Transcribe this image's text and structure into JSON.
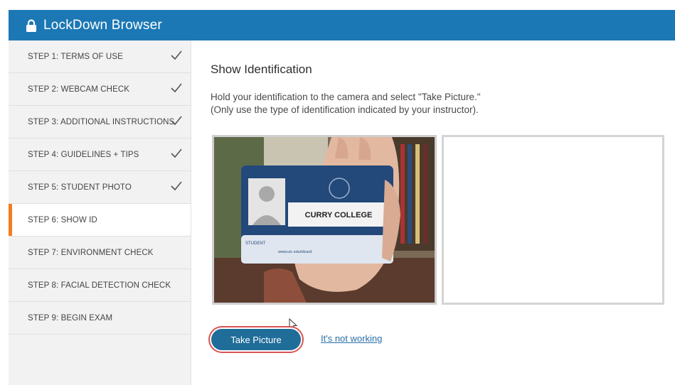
{
  "window": {
    "title": "LockDown Browser",
    "titlebar_color": "#1b78b5",
    "accent_color": "#ef7d22"
  },
  "sidebar": {
    "items": [
      {
        "label": "STEP 1: TERMS OF USE",
        "completed": true
      },
      {
        "label": "STEP 2: WEBCAM CHECK",
        "completed": true
      },
      {
        "label": "STEP 3: ADDITIONAL INSTRUCTIONS",
        "completed": true
      },
      {
        "label": "STEP 4: GUIDELINES + TIPS",
        "completed": true
      },
      {
        "label": "STEP 5: STUDENT PHOTO",
        "completed": true
      },
      {
        "label": "STEP 6: SHOW ID",
        "completed": false,
        "active": true
      },
      {
        "label": "STEP 7: ENVIRONMENT CHECK",
        "completed": false
      },
      {
        "label": "STEP 8: FACIAL DETECTION CHECK",
        "completed": false
      },
      {
        "label": "STEP 9: BEGIN EXAM",
        "completed": false
      }
    ]
  },
  "main": {
    "heading": "Show Identification",
    "instruction_line1": "Hold your identification to the camera and select \"Take Picture.\"",
    "instruction_line2": "(Only use the type of identification indicated by your instructor).",
    "id_card": {
      "school": "CURRY COLLEGE",
      "role": "STUDENT",
      "url": "www.uic.edu/idcard"
    },
    "take_picture_label": "Take Picture",
    "not_working_label": "It's not working"
  }
}
